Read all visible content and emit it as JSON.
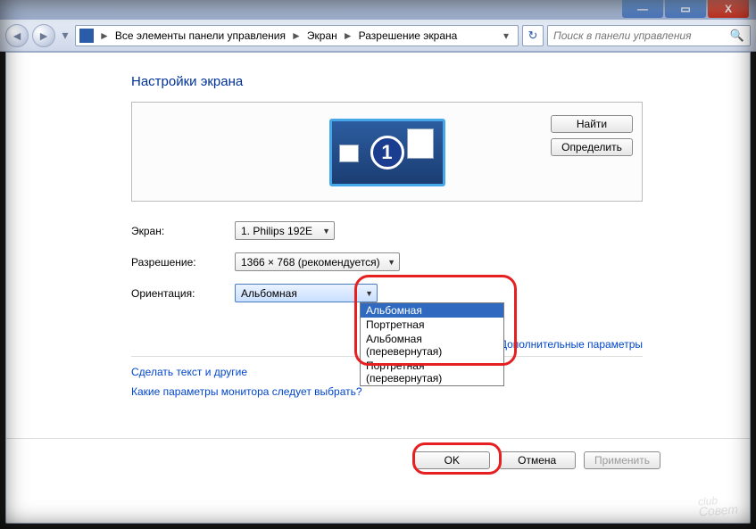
{
  "titlebar": {
    "min": "—",
    "max": "▭",
    "close": "X"
  },
  "nav": {
    "back": "◄",
    "fwd": "►",
    "drop": "▾",
    "crumb1": "Все элементы панели управления",
    "crumb2": "Экран",
    "crumb3": "Разрешение экрана",
    "sep": "►",
    "refresh": "↻",
    "search_placeholder": "Поиск в панели управления",
    "search_icon": "🔍"
  },
  "page": {
    "heading": "Настройки экрана",
    "display_number": "1",
    "find_btn": "Найти",
    "detect_btn": "Определить",
    "screen_label": "Экран:",
    "screen_value": "1. Philips 192E",
    "res_label": "Разрешение:",
    "res_value": "1366 × 768 (рекомендуется)",
    "orient_label": "Ориентация:",
    "orient_value": "Альбомная",
    "orient_options": [
      "Альбомная",
      "Портретная",
      "Альбомная (перевернутая)",
      "Портретная (перевернутая)"
    ],
    "adv_link": "Дополнительные параметры",
    "text_link": "Сделать текст и другие",
    "which_link": "Какие параметры монитора следует выбрать?",
    "ok": "OK",
    "cancel": "Отмена",
    "apply": "Применить"
  },
  "watermark": {
    "top": "club",
    "bot": "Совет"
  }
}
